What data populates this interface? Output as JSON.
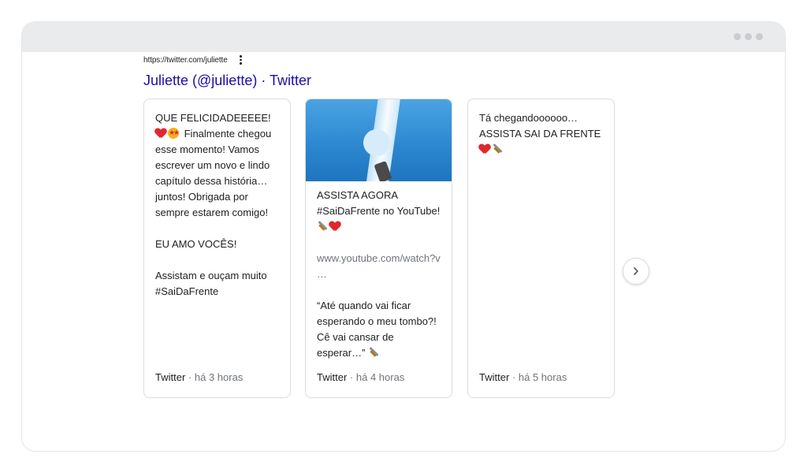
{
  "result": {
    "url": "https://twitter.com/juliette",
    "title": "Juliette (@juliette) · Twitter"
  },
  "cards": [
    {
      "p1": "QUE FELICIDADEEEEE!",
      "p1b": " Finalmente chegou esse momento! Vamos escrever um novo e lindo capítulo dessa história… juntos! Obrigada por sempre estarem comigo!",
      "p2": "EU AMO VOCÊS!",
      "p3": "Assistam e ouçam muito #SaiDaFrente",
      "source": "Twitter",
      "separator": "·",
      "time": "há 3 horas",
      "emojis": [
        "heart",
        "heart-eyes-face"
      ]
    },
    {
      "p1": "ASSISTA AGORA #SaiDaFrente no YouTube!",
      "link": "www.youtube.com/watch?v …",
      "quote": "“Até quando vai ficar esperando o meu tombo?! Cê vai cansar de esperar…”",
      "source": "Twitter",
      "separator": "·",
      "time": "há 4 horas",
      "emojis": [
        "sword",
        "heart",
        "sword"
      ]
    },
    {
      "p1": "Tá chegandoooooo… ASSISTA SAI DA FRENTE",
      "source": "Twitter",
      "separator": "·",
      "time": "há 5 horas",
      "emojis": [
        "heart",
        "sword"
      ]
    }
  ],
  "icons": {
    "more": "more-vert-icon",
    "next": "chevron-right-icon",
    "window_dots": "window-dots-icon"
  },
  "colors": {
    "link": "#1a0dab",
    "muted": "#70757a",
    "chrome": "#e9ebed"
  }
}
